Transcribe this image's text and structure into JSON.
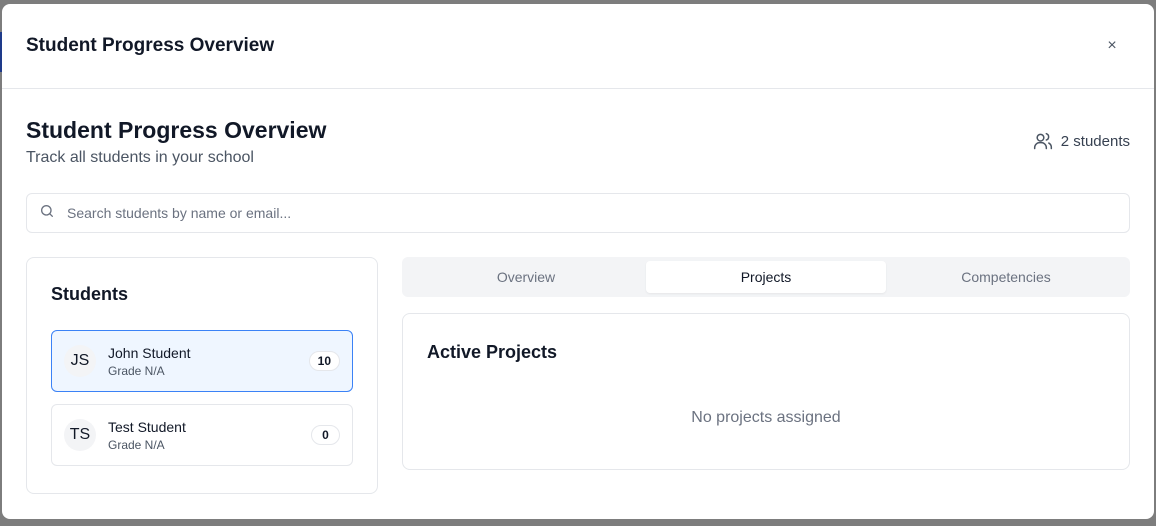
{
  "modal": {
    "title": "Student Progress Overview",
    "close_label": "×"
  },
  "page": {
    "title": "Student Progress Overview",
    "subtitle": "Track all students in your school",
    "student_count": "2 students"
  },
  "search": {
    "placeholder": "Search students by name or email...",
    "value": ""
  },
  "students_panel": {
    "heading": "Students",
    "items": [
      {
        "initials": "JS",
        "name": "John Student",
        "grade": "Grade N/A",
        "count": "10",
        "selected": true
      },
      {
        "initials": "TS",
        "name": "Test Student",
        "grade": "Grade N/A",
        "count": "0",
        "selected": false
      }
    ]
  },
  "tabs": [
    {
      "label": "Overview",
      "active": false
    },
    {
      "label": "Projects",
      "active": true
    },
    {
      "label": "Competencies",
      "active": false
    }
  ],
  "projects": {
    "heading": "Active Projects",
    "empty_text": "No projects assigned"
  },
  "colors": {
    "selected_border": "#3b82f6",
    "selected_bg": "#eff6ff",
    "backdrop": "#7d7d7d"
  }
}
